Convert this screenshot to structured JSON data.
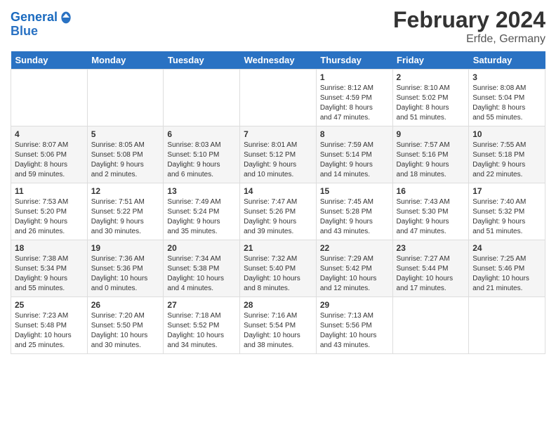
{
  "header": {
    "logo_line1": "General",
    "logo_line2": "Blue",
    "title": "February 2024",
    "subtitle": "Erfde, Germany"
  },
  "days_of_week": [
    "Sunday",
    "Monday",
    "Tuesday",
    "Wednesday",
    "Thursday",
    "Friday",
    "Saturday"
  ],
  "weeks": [
    [
      {
        "day": "",
        "info": ""
      },
      {
        "day": "",
        "info": ""
      },
      {
        "day": "",
        "info": ""
      },
      {
        "day": "",
        "info": ""
      },
      {
        "day": "1",
        "info": "Sunrise: 8:12 AM\nSunset: 4:59 PM\nDaylight: 8 hours\nand 47 minutes."
      },
      {
        "day": "2",
        "info": "Sunrise: 8:10 AM\nSunset: 5:02 PM\nDaylight: 8 hours\nand 51 minutes."
      },
      {
        "day": "3",
        "info": "Sunrise: 8:08 AM\nSunset: 5:04 PM\nDaylight: 8 hours\nand 55 minutes."
      }
    ],
    [
      {
        "day": "4",
        "info": "Sunrise: 8:07 AM\nSunset: 5:06 PM\nDaylight: 8 hours\nand 59 minutes."
      },
      {
        "day": "5",
        "info": "Sunrise: 8:05 AM\nSunset: 5:08 PM\nDaylight: 9 hours\nand 2 minutes."
      },
      {
        "day": "6",
        "info": "Sunrise: 8:03 AM\nSunset: 5:10 PM\nDaylight: 9 hours\nand 6 minutes."
      },
      {
        "day": "7",
        "info": "Sunrise: 8:01 AM\nSunset: 5:12 PM\nDaylight: 9 hours\nand 10 minutes."
      },
      {
        "day": "8",
        "info": "Sunrise: 7:59 AM\nSunset: 5:14 PM\nDaylight: 9 hours\nand 14 minutes."
      },
      {
        "day": "9",
        "info": "Sunrise: 7:57 AM\nSunset: 5:16 PM\nDaylight: 9 hours\nand 18 minutes."
      },
      {
        "day": "10",
        "info": "Sunrise: 7:55 AM\nSunset: 5:18 PM\nDaylight: 9 hours\nand 22 minutes."
      }
    ],
    [
      {
        "day": "11",
        "info": "Sunrise: 7:53 AM\nSunset: 5:20 PM\nDaylight: 9 hours\nand 26 minutes."
      },
      {
        "day": "12",
        "info": "Sunrise: 7:51 AM\nSunset: 5:22 PM\nDaylight: 9 hours\nand 30 minutes."
      },
      {
        "day": "13",
        "info": "Sunrise: 7:49 AM\nSunset: 5:24 PM\nDaylight: 9 hours\nand 35 minutes."
      },
      {
        "day": "14",
        "info": "Sunrise: 7:47 AM\nSunset: 5:26 PM\nDaylight: 9 hours\nand 39 minutes."
      },
      {
        "day": "15",
        "info": "Sunrise: 7:45 AM\nSunset: 5:28 PM\nDaylight: 9 hours\nand 43 minutes."
      },
      {
        "day": "16",
        "info": "Sunrise: 7:43 AM\nSunset: 5:30 PM\nDaylight: 9 hours\nand 47 minutes."
      },
      {
        "day": "17",
        "info": "Sunrise: 7:40 AM\nSunset: 5:32 PM\nDaylight: 9 hours\nand 51 minutes."
      }
    ],
    [
      {
        "day": "18",
        "info": "Sunrise: 7:38 AM\nSunset: 5:34 PM\nDaylight: 9 hours\nand 55 minutes."
      },
      {
        "day": "19",
        "info": "Sunrise: 7:36 AM\nSunset: 5:36 PM\nDaylight: 10 hours\nand 0 minutes."
      },
      {
        "day": "20",
        "info": "Sunrise: 7:34 AM\nSunset: 5:38 PM\nDaylight: 10 hours\nand 4 minutes."
      },
      {
        "day": "21",
        "info": "Sunrise: 7:32 AM\nSunset: 5:40 PM\nDaylight: 10 hours\nand 8 minutes."
      },
      {
        "day": "22",
        "info": "Sunrise: 7:29 AM\nSunset: 5:42 PM\nDaylight: 10 hours\nand 12 minutes."
      },
      {
        "day": "23",
        "info": "Sunrise: 7:27 AM\nSunset: 5:44 PM\nDaylight: 10 hours\nand 17 minutes."
      },
      {
        "day": "24",
        "info": "Sunrise: 7:25 AM\nSunset: 5:46 PM\nDaylight: 10 hours\nand 21 minutes."
      }
    ],
    [
      {
        "day": "25",
        "info": "Sunrise: 7:23 AM\nSunset: 5:48 PM\nDaylight: 10 hours\nand 25 minutes."
      },
      {
        "day": "26",
        "info": "Sunrise: 7:20 AM\nSunset: 5:50 PM\nDaylight: 10 hours\nand 30 minutes."
      },
      {
        "day": "27",
        "info": "Sunrise: 7:18 AM\nSunset: 5:52 PM\nDaylight: 10 hours\nand 34 minutes."
      },
      {
        "day": "28",
        "info": "Sunrise: 7:16 AM\nSunset: 5:54 PM\nDaylight: 10 hours\nand 38 minutes."
      },
      {
        "day": "29",
        "info": "Sunrise: 7:13 AM\nSunset: 5:56 PM\nDaylight: 10 hours\nand 43 minutes."
      },
      {
        "day": "",
        "info": ""
      },
      {
        "day": "",
        "info": ""
      }
    ]
  ]
}
